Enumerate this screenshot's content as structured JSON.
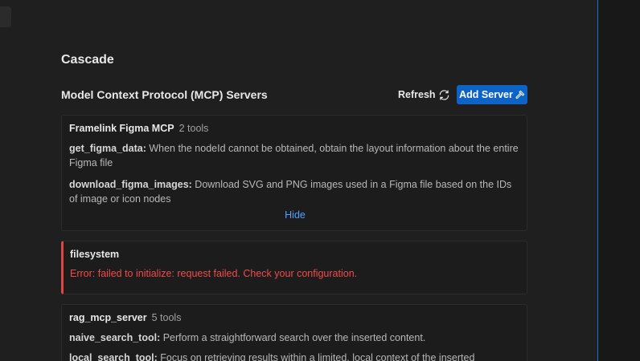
{
  "cascade": {
    "title": "Cascade"
  },
  "mcp": {
    "title": "Model Context Protocol (MCP) Servers",
    "refresh_label": "Refresh",
    "add_server_label": "Add Server"
  },
  "servers": [
    {
      "name": "Framelink Figma MCP",
      "tool_count": "2 tools",
      "tools": [
        {
          "name": "get_figma_data:",
          "description": " When the nodeId cannot be obtained, obtain the layout information about the entire Figma file"
        },
        {
          "name": "download_figma_images:",
          "description": " Download SVG and PNG images used in a Figma file based on the IDs of image or icon nodes"
        }
      ],
      "toggle_label": "Hide"
    },
    {
      "name": "filesystem",
      "error": "Error: failed to initialize: request failed. Check your configuration."
    },
    {
      "name": "rag_mcp_server",
      "tool_count": "5 tools",
      "tools": [
        {
          "name": "naive_search_tool:",
          "description": " Perform a straightforward search over the inserted content."
        },
        {
          "name": "local_search_tool:",
          "description": " Focus on retrieving results within a limited, local context of the inserted"
        }
      ]
    }
  ],
  "colors": {
    "accent": "#0e63c6",
    "error": "#f04b4b",
    "link": "#4da3ff"
  },
  "icons": {
    "refresh": "refresh-icon",
    "add_server": "hammer-icon"
  }
}
